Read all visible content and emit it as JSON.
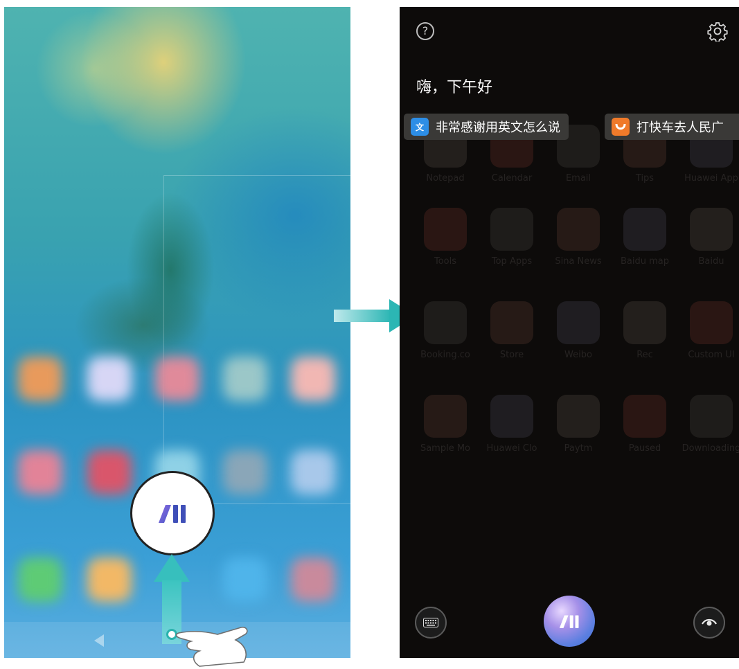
{
  "left": {
    "assistant_logo": "AI",
    "colors": {
      "arrow": "#37bfbd",
      "wallpaper_top": "#4fb3b0",
      "wallpaper_bottom": "#5aaee0"
    }
  },
  "right": {
    "help_symbol": "?",
    "greeting": "嗨，下午好",
    "suggestions": [
      {
        "label": "非常感谢用英文怎么说",
        "icon": "translate-icon"
      },
      {
        "label": "打快车去人民广",
        "icon": "didi-icon"
      }
    ],
    "voice_logo": "AI",
    "ghost_apps": [
      [
        "Notepad",
        "Calendar",
        "Email",
        "Tips",
        "Huawei App"
      ],
      [
        "Tools",
        "Top Apps",
        "Sina News",
        "Baidu map",
        "Baidu"
      ],
      [
        "Booking.co",
        "Store",
        "Weibo",
        "Rec",
        "Custom UI"
      ],
      [
        "Sample Mo",
        "Huawei Clo",
        "Paytm",
        "Paused",
        "Downloading"
      ]
    ],
    "colors": {
      "background": "#0d0b0a",
      "chip": "#3a3937",
      "voice_button": "#7e86e6"
    }
  }
}
